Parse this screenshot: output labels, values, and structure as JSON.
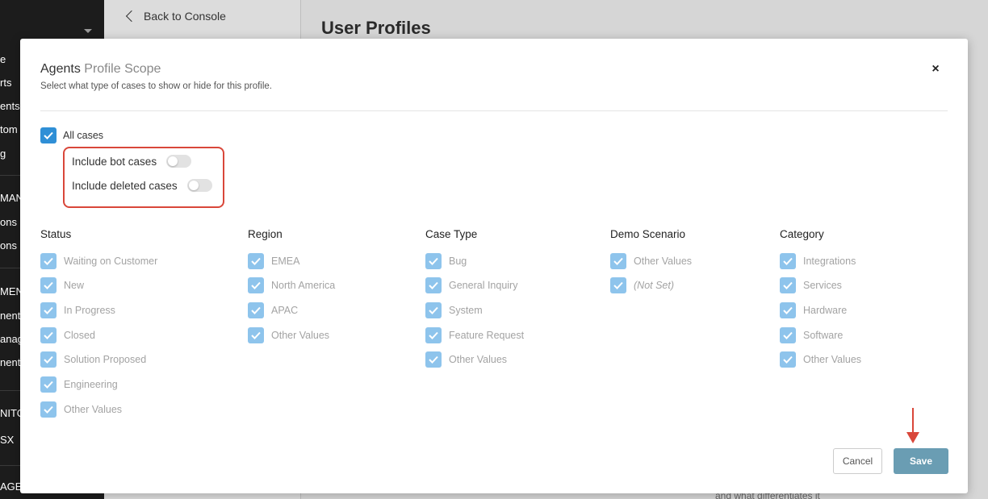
{
  "app": {
    "back_label": "Back to Console",
    "page_title": "User Profiles",
    "sidebar": [
      "e",
      "rts",
      "ents",
      "tom",
      "g",
      "MAN",
      "ons",
      "ons",
      "MEN",
      "nent",
      "anag",
      "nent",
      "NITO",
      "SX",
      "AGEN"
    ],
    "bottom_snippet": "and what differentiates it"
  },
  "modal": {
    "title_main": "Agents",
    "title_scope": "Profile Scope",
    "subtitle": "Select what type of cases to show or hide for this profile.",
    "close_label": "×",
    "all_cases_label": "All cases",
    "toggles": [
      {
        "label": "Include bot cases",
        "on": false
      },
      {
        "label": "Include deleted cases",
        "on": false
      }
    ],
    "columns": [
      {
        "header": "Status",
        "items": [
          "Waiting on Customer",
          "New",
          "In Progress",
          "Closed",
          "Solution Proposed",
          "Engineering",
          "Other Values"
        ]
      },
      {
        "header": "Region",
        "items": [
          "EMEA",
          "North America",
          "APAC",
          "Other Values"
        ]
      },
      {
        "header": "Case Type",
        "items": [
          "Bug",
          "General Inquiry",
          "System",
          "Feature Request",
          "Other Values"
        ]
      },
      {
        "header": "Demo Scenario",
        "items": [
          "Other Values",
          "(Not Set)"
        ]
      },
      {
        "header": "Category",
        "items": [
          "Integrations",
          "Services",
          "Hardware",
          "Software",
          "Other Values"
        ]
      }
    ],
    "cancel_label": "Cancel",
    "save_label": "Save"
  },
  "colors": {
    "checkbox_active": "#2f8fd6",
    "checkbox_disabled": "#8ec4ec",
    "save_button": "#6a9db3",
    "highlight": "#d9473a"
  }
}
